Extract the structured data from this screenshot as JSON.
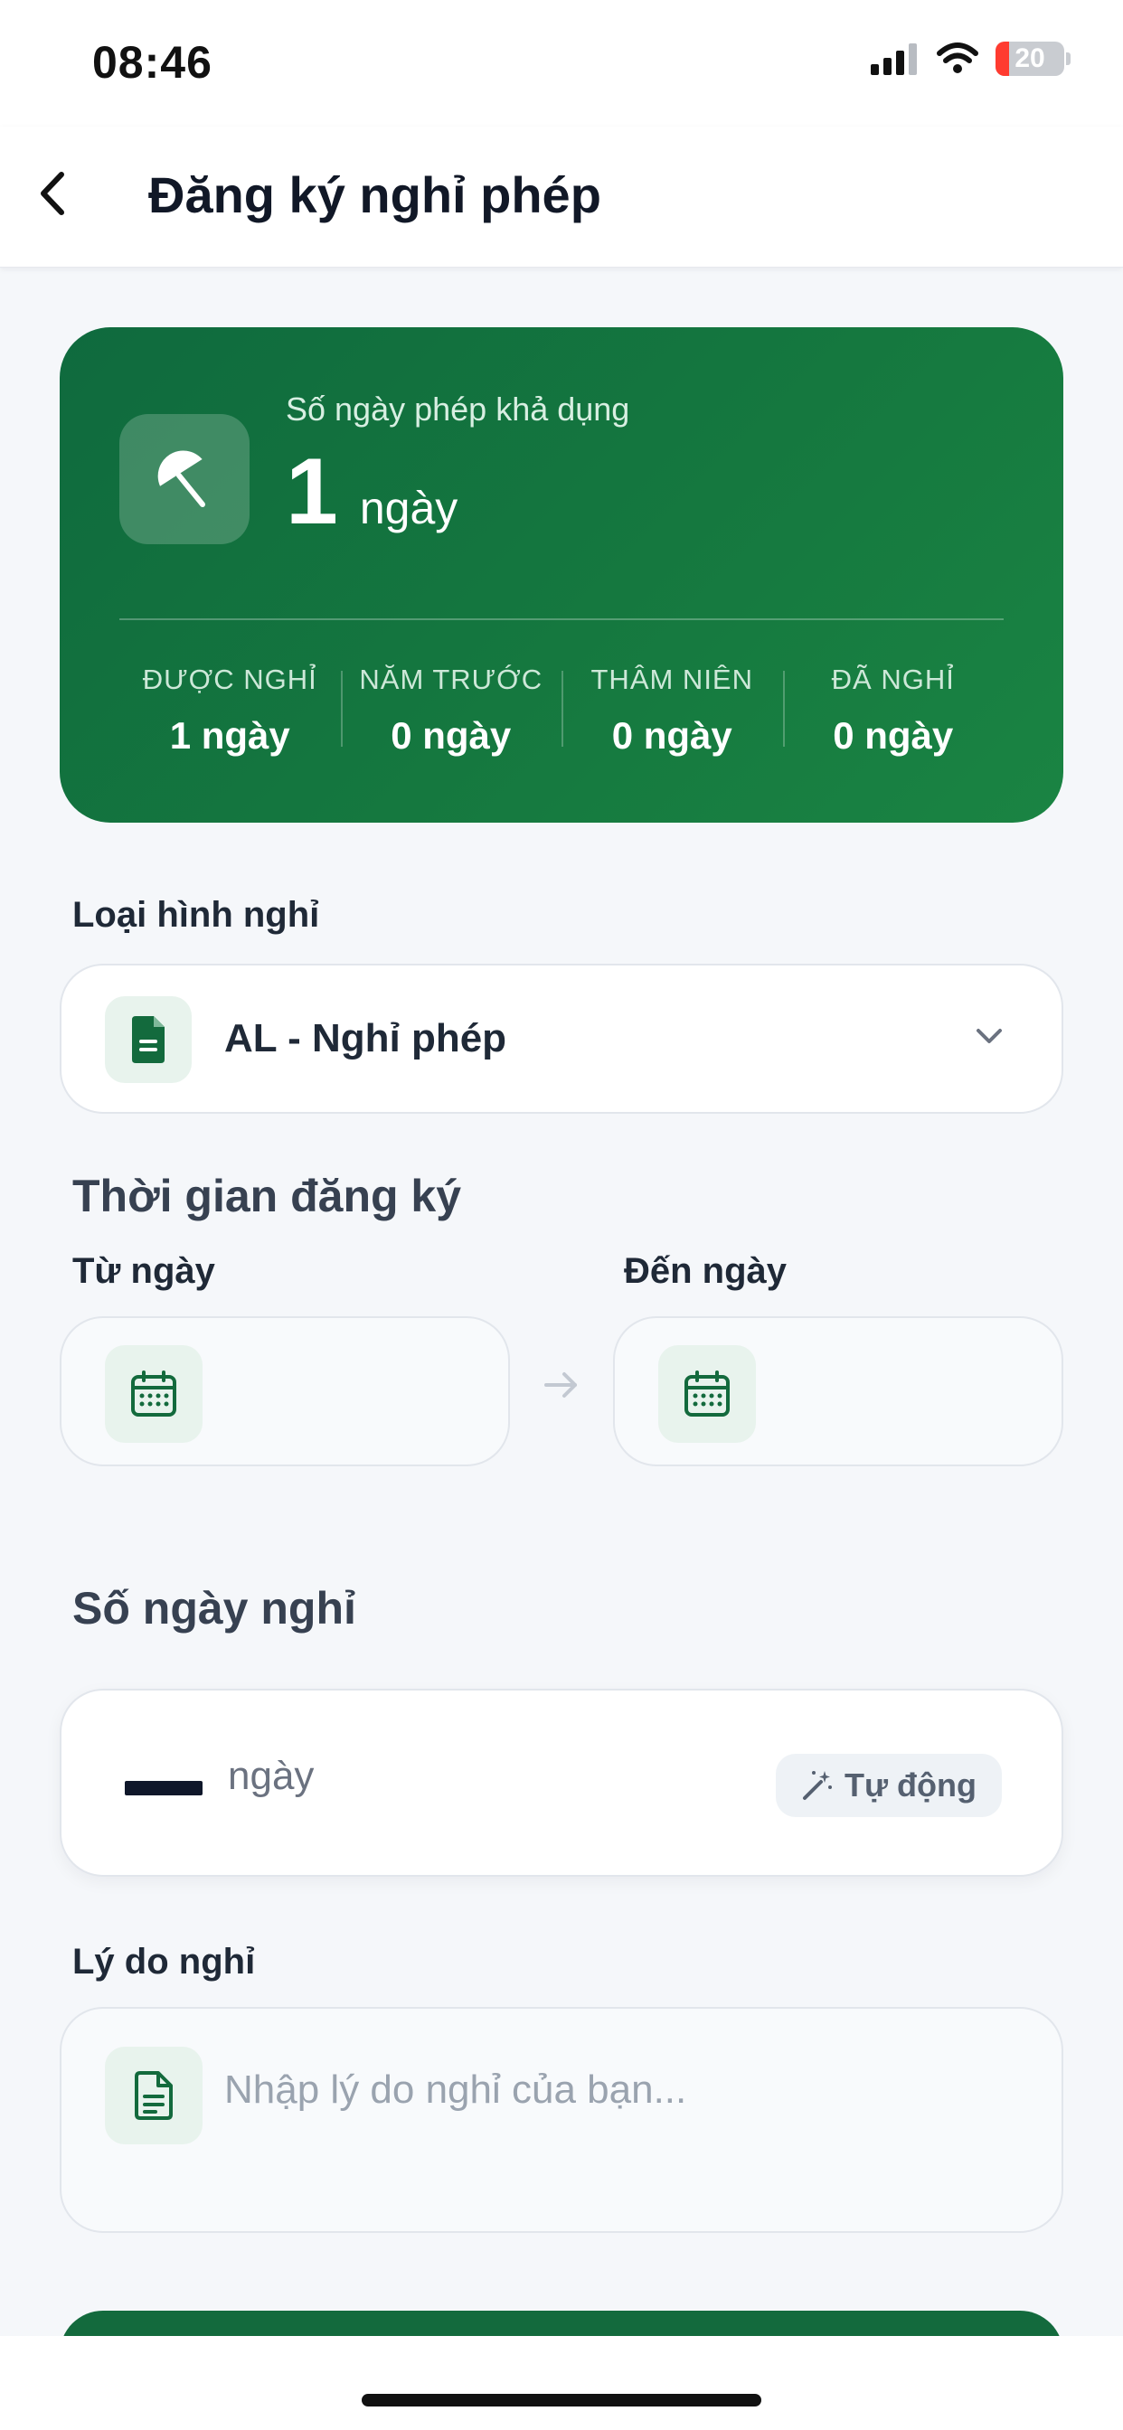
{
  "status_bar": {
    "time": "08:46",
    "battery_level": "20",
    "battery_percent": 20
  },
  "header": {
    "title": "Đăng ký nghỉ phép"
  },
  "balance": {
    "label": "Số ngày phép khả dụng",
    "value": "1",
    "unit": "ngày",
    "stats": [
      {
        "label": "ĐƯỢC NGHỈ",
        "value": "1 ngày"
      },
      {
        "label": "NĂM TRƯỚC",
        "value": "0 ngày"
      },
      {
        "label": "THÂM NIÊN",
        "value": "0 ngày"
      },
      {
        "label": "ĐÃ NGHỈ",
        "value": "0 ngày"
      }
    ]
  },
  "leave_type": {
    "label": "Loại hình nghỉ",
    "selected": "AL - Nghỉ phép"
  },
  "period": {
    "title": "Thời gian đăng ký",
    "from_label": "Từ ngày",
    "to_label": "Đến ngày"
  },
  "days": {
    "title": "Số ngày nghỉ",
    "unit": "ngày",
    "auto_label": "Tự động"
  },
  "reason": {
    "label": "Lý do nghỉ",
    "placeholder": "Nhập lý do nghỉ của bạn..."
  },
  "colors": {
    "primary": "#136a3d",
    "accent_light": "#e8f3ed",
    "background": "#f5f7fa"
  }
}
